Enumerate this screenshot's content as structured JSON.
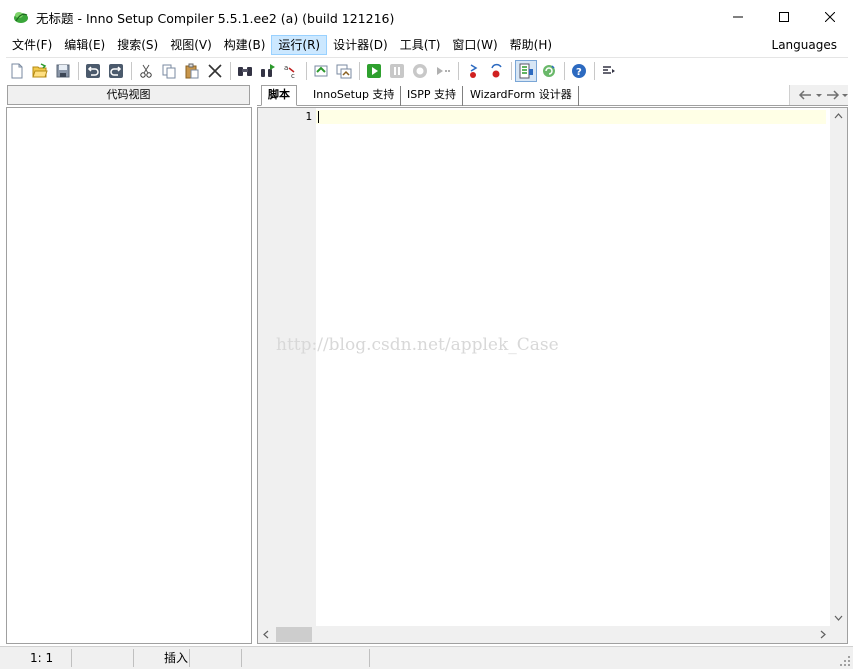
{
  "window": {
    "title": "无标题 - Inno Setup Compiler 5.5.1.ee2 (a) (build 121216)",
    "minimize_glyph": "—",
    "maximize_glyph": "☐",
    "close_glyph": "✕"
  },
  "menu": {
    "items": [
      "文件(F)",
      "编辑(E)",
      "搜索(S)",
      "视图(V)",
      "构建(B)",
      "运行(R)",
      "设计器(D)",
      "工具(T)",
      "窗口(W)",
      "帮助(H)"
    ],
    "active_index": 5,
    "languages": "Languages"
  },
  "toolbar": {
    "icons": [
      "new-file-icon",
      "open-folder-icon",
      "save-icon",
      "undo-icon",
      "redo-icon",
      "cut-icon",
      "copy-icon",
      "paste-icon",
      "delete-icon",
      "find-icon",
      "find-next-icon",
      "replace-icon",
      "compile-icon",
      "compile-all-icon",
      "run-icon",
      "pause-icon",
      "stop-icon",
      "step-icon",
      "toggle-breakpoint-icon",
      "clear-breakpoints-icon",
      "show-code-view-icon",
      "refresh-icon",
      "help-icon",
      "insert-icon"
    ]
  },
  "left_panel": {
    "header": "代码视图"
  },
  "tabs": {
    "items": [
      "脚本",
      "InnoSetup 支持",
      "ISPP 支持",
      "WizardForm 设计器"
    ],
    "active_index": 0
  },
  "editor": {
    "line_number": "1",
    "watermark": "http://blog.csdn.net/applek_Case"
  },
  "status": {
    "position": "1:   1",
    "mode": "插入"
  }
}
